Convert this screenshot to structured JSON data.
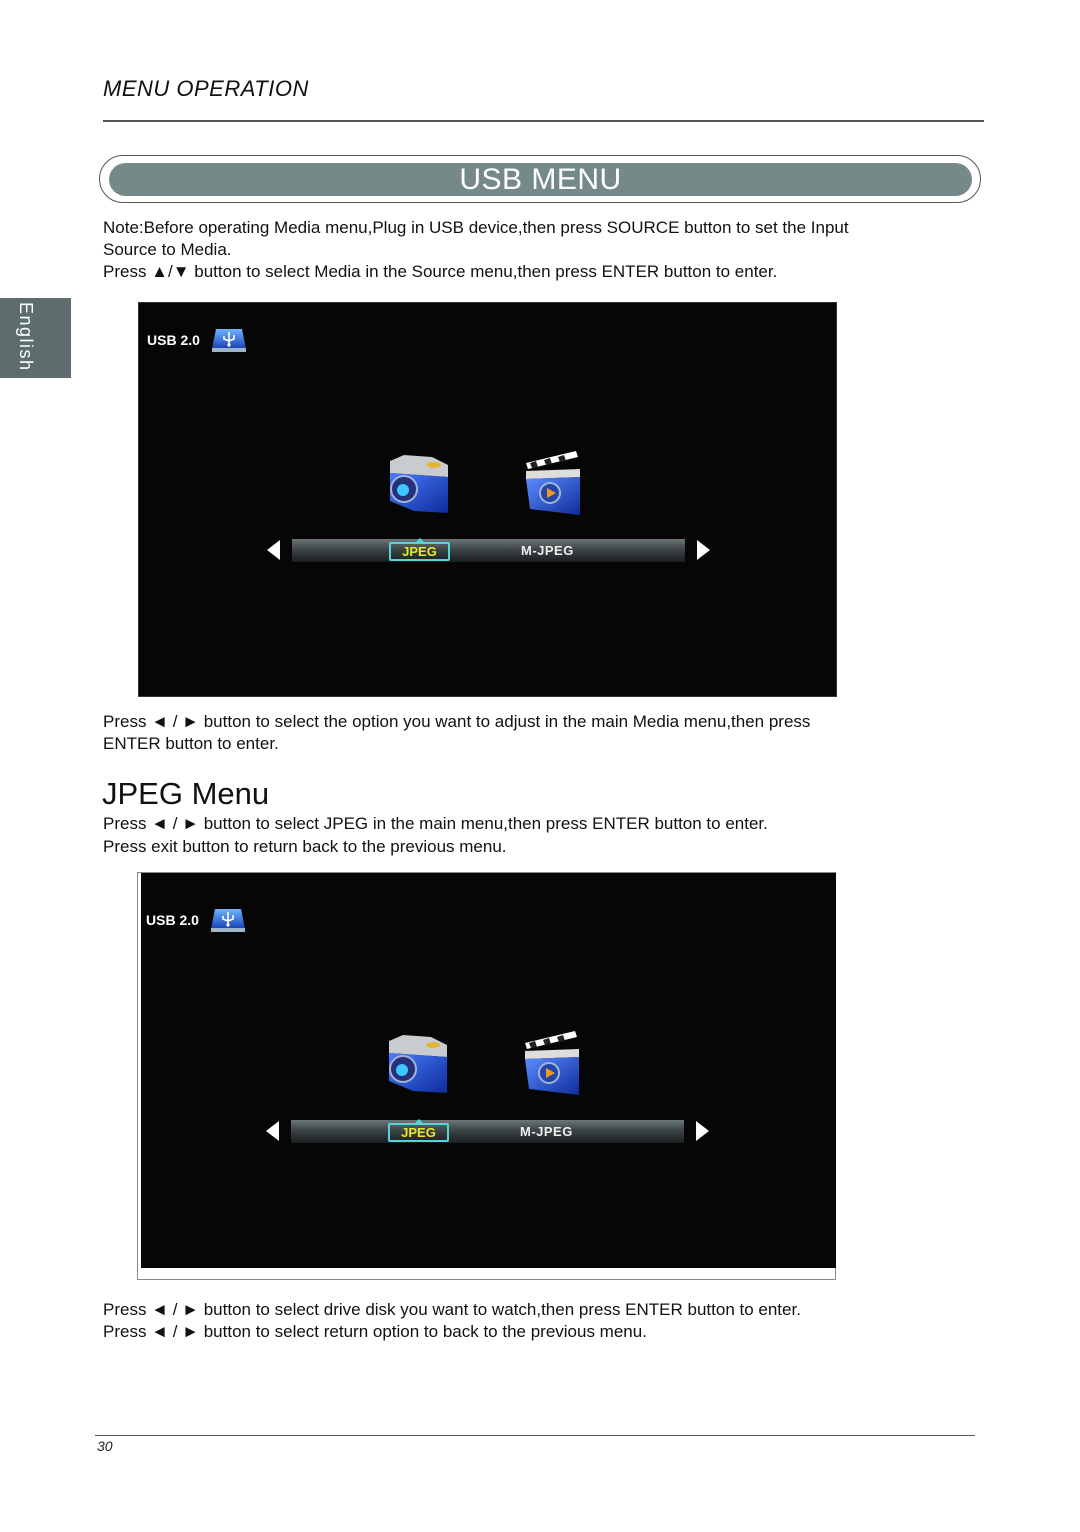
{
  "header": {
    "section_title": "MENU OPERATION",
    "banner_title": "USB MENU"
  },
  "side_tab": {
    "language": "English"
  },
  "intro": {
    "note_line1": "Note:Before operating Media menu,Plug in USB device,then press SOURCE button to set the Input",
    "note_line2": "Source to Media.",
    "press_line": "Press ▲/▼ button to select Media in the Source menu,then press ENTER button to enter."
  },
  "screens": [
    {
      "usb_label": "USB 2.0",
      "icons": [
        "usb-drive-icon",
        "camera-icon",
        "film-clapper-icon"
      ],
      "options": [
        "JPEG",
        "M-JPEG"
      ],
      "selected_option": "JPEG",
      "colors": {
        "selected_text": "#e6e82a",
        "selected_border": "#58d3d8",
        "background": "#050605"
      }
    },
    {
      "usb_label": "USB 2.0",
      "icons": [
        "usb-drive-icon",
        "camera-icon",
        "film-clapper-icon"
      ],
      "options": [
        "JPEG",
        "M-JPEG"
      ],
      "selected_option": "JPEG",
      "colors": {
        "selected_text": "#e6e82a",
        "selected_border": "#58d3d8",
        "background": "#050605"
      }
    }
  ],
  "after_screen1": {
    "line1": "Press ◄ / ► button to select the option you want to adjust in the main Media menu,then press",
    "line2": "ENTER button to enter."
  },
  "jpeg_section": {
    "heading": "JPEG Menu",
    "line1": "Press ◄ / ► button to select JPEG in the main menu,then press ENTER button to enter.",
    "line2": "Press exit button to return back to the previous menu."
  },
  "after_screen2": {
    "line1": "Press ◄ / ► button to select drive disk you want to watch,then press ENTER button to enter.",
    "line2": "Press ◄ / ► button to select return option to back to the previous menu."
  },
  "footer": {
    "page_number": "30"
  },
  "colors": {
    "banner": "#758a88",
    "side_tab": "#5d6d6e"
  }
}
